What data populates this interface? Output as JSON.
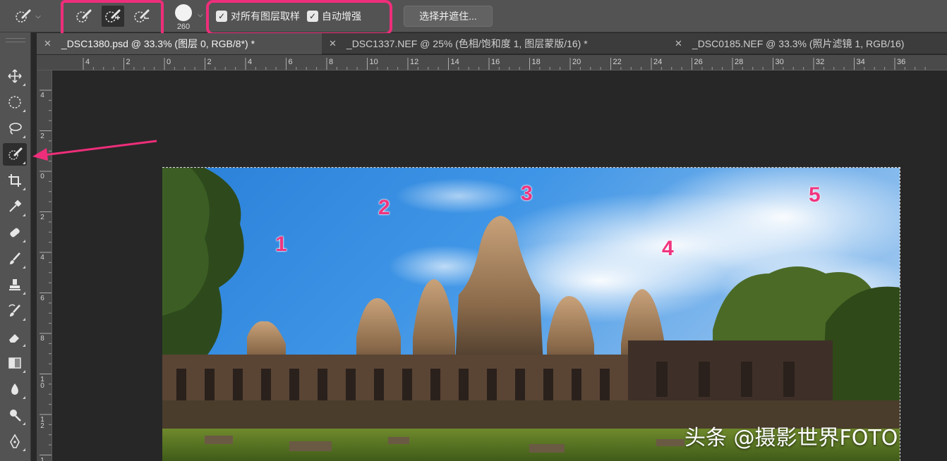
{
  "options_bar": {
    "brush_size": "260",
    "checkbox_sample_all_layers": "对所有图层取样",
    "checkbox_auto_enhance": "自动增强",
    "select_and_mask": "选择并遮住..."
  },
  "tabs": [
    {
      "label": "_DSC1380.psd @ 33.3% (图层 0, RGB/8*) *",
      "active": true
    },
    {
      "label": "_DSC1337.NEF @ 25% (色相/饱和度 1, 图层蒙版/16) *",
      "active": false
    },
    {
      "label": "_DSC0185.NEF @ 33.3% (照片滤镜 1, RGB/16)",
      "active": false
    }
  ],
  "ruler_h": [
    "4",
    "2",
    "0",
    "2",
    "4",
    "6",
    "8",
    "10",
    "12",
    "14",
    "16",
    "18",
    "20",
    "22",
    "24",
    "26",
    "28",
    "30",
    "32",
    "34",
    "36"
  ],
  "ruler_v": [
    "4",
    "2",
    "0",
    "2",
    "4",
    "6",
    "8",
    "10",
    "12",
    "14"
  ],
  "tools": [
    "move-icon",
    "marquee-icon",
    "lasso-icon",
    "quick-selection-icon",
    "crop-icon",
    "eyedropper-icon",
    "healing-brush-icon",
    "brush-icon",
    "clone-stamp-icon",
    "history-brush-icon",
    "eraser-icon",
    "gradient-icon",
    "blur-icon",
    "dodge-icon",
    "pen-icon"
  ],
  "annotations": [
    "1",
    "2",
    "3",
    "4",
    "5"
  ],
  "watermark": "头条 @摄影世界FOTO",
  "colors": {
    "highlight": "#ee2e7a",
    "annotation": "#f0357f"
  }
}
